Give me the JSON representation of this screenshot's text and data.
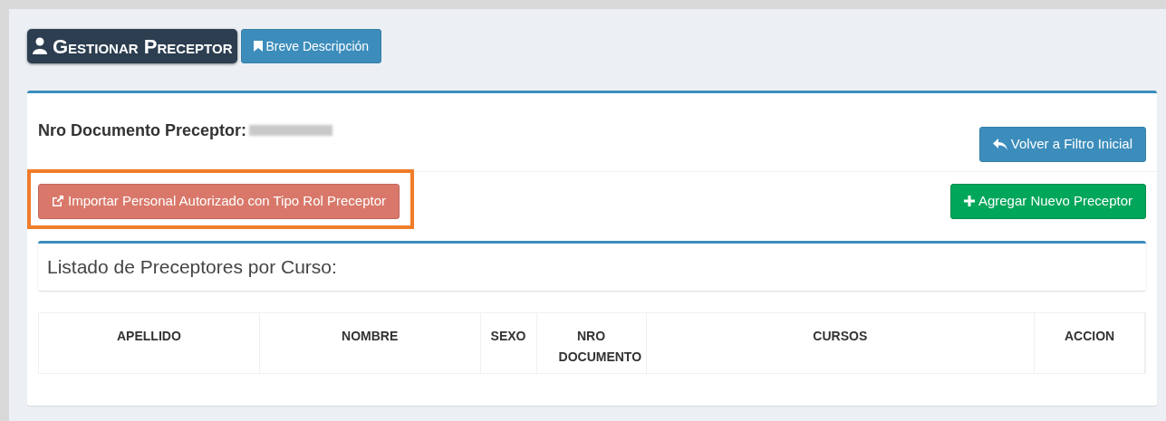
{
  "header": {
    "title": "Gestionar Preceptor",
    "description_button": "Breve Descripción"
  },
  "document_label": "Nro Documento Preceptor:",
  "back_button": "Volver a Filtro Inicial",
  "import_button": {
    "label": "Importar Personal Autorizado con Tipo Rol Preceptor",
    "highlighted": true
  },
  "add_button": "Agregar Nuevo Preceptor",
  "list_title": "Listado de Preceptores por Curso:",
  "table": {
    "columns": [
      "APELLIDO",
      "NOMBRE",
      "SEXO",
      "NRO DOCUMENTO",
      "CURSOS",
      "ACCION"
    ]
  }
}
